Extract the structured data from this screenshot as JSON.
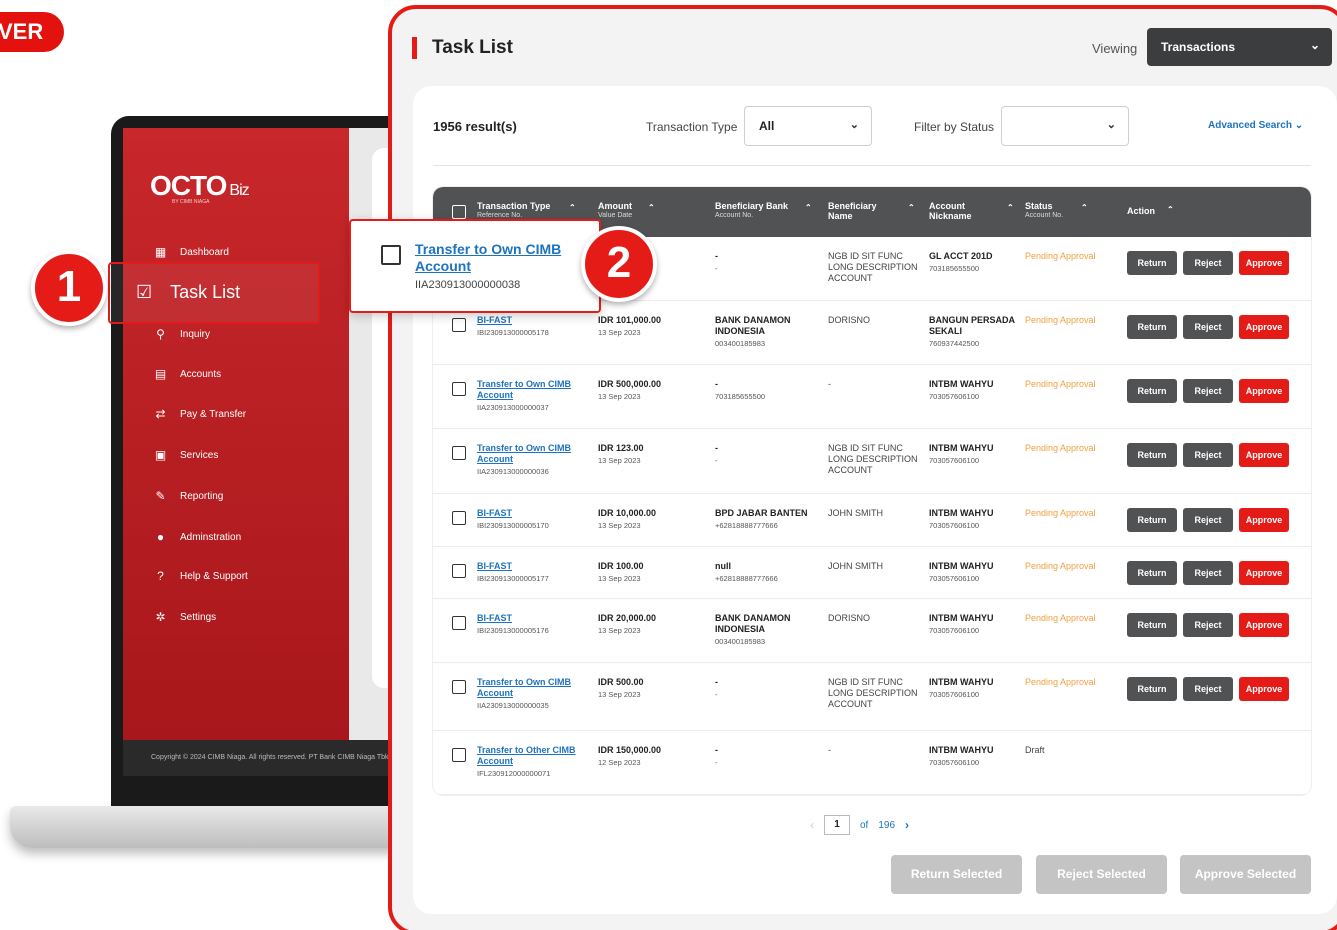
{
  "corner_pill": {
    "text": "VER"
  },
  "app": {
    "logo_text": "OCTO",
    "logo_suffix": "Biz",
    "logo_sub": "BY CIMB NIAGA",
    "footer": "Copyright © 2024 CIMB Niaga. All rights reserved. PT Bank CIMB Niaga Tbk",
    "nav": [
      {
        "label": "Dashboard",
        "icon": "dashboard-icon"
      },
      {
        "label": "Task List",
        "icon": "clipboard-check-icon"
      },
      {
        "label": "Inquiry",
        "icon": "search-icon"
      },
      {
        "label": "Accounts",
        "icon": "accounts-icon"
      },
      {
        "label": "Pay & Transfer",
        "icon": "transfer-icon"
      },
      {
        "label": "Services",
        "icon": "services-icon"
      },
      {
        "label": "Reporting",
        "icon": "wrench-icon"
      },
      {
        "label": "Adminstration",
        "icon": "user-icon"
      },
      {
        "label": "Help & Support",
        "icon": "help-icon"
      },
      {
        "label": "Settings",
        "icon": "gear-icon"
      }
    ]
  },
  "badges": {
    "one": "1",
    "two": "2"
  },
  "header": {
    "title": "Task List",
    "viewing_label": "Viewing",
    "viewing_value": "Transactions"
  },
  "filters": {
    "results": "1956 result(s)",
    "type_label": "Transaction Type",
    "type_value": "All",
    "status_label": "Filter by Status",
    "status_value": "",
    "advanced": "Advanced Search"
  },
  "table": {
    "columns": [
      {
        "label": "Transaction Type",
        "sub": "Reference No."
      },
      {
        "label": "Amount",
        "sub": "Value Date"
      },
      {
        "label": "Beneficiary Bank",
        "sub": "Account No."
      },
      {
        "label": "Beneficiary",
        "sub": "Name"
      },
      {
        "label": "Account",
        "sub": "Nickname"
      },
      {
        "label": "Status",
        "sub": "Account No."
      },
      {
        "label": "Action",
        "sub": ""
      }
    ],
    "buttons": {
      "return": "Return",
      "reject": "Reject",
      "approve": "Approve"
    },
    "rows": [
      {
        "type": "Transfer to Own CIMB Account",
        "ref": "IIA230913000000038",
        "amount": "",
        "date": "",
        "bank": "-",
        "bank_acc": "-",
        "beneficiary": "NGB ID SIT FUNC LONG DESCRIPTION ACCOUNT",
        "nickname": "GL ACCT 201D",
        "nick_acc": "703185655500",
        "status": "Pending Approval",
        "actions": true
      },
      {
        "type": "BI-FAST",
        "ref": "IBI230913000005178",
        "amount": "IDR 101,000.00",
        "date": "13 Sep 2023",
        "bank": "BANK DANAMON INDONESIA",
        "bank_acc": "003400185983",
        "beneficiary": "DORISNO",
        "nickname": "BANGUN PERSADA SEKALI",
        "nick_acc": "760937442500",
        "status": "Pending Approval",
        "actions": true
      },
      {
        "type": "Transfer to Own CIMB Account",
        "ref": "IIA230913000000037",
        "amount": "IDR 500,000.00",
        "date": "13 Sep 2023",
        "bank": "-",
        "bank_acc": "703185655500",
        "beneficiary": "-",
        "nickname": "INTBM WAHYU",
        "nick_acc": "703057606100",
        "status": "Pending Approval",
        "actions": true
      },
      {
        "type": "Transfer to Own CIMB Account",
        "ref": "IIA230913000000036",
        "amount": "IDR 123.00",
        "date": "13 Sep 2023",
        "bank": "-",
        "bank_acc": "-",
        "beneficiary": "NGB ID SIT FUNC LONG DESCRIPTION ACCOUNT",
        "nickname": "INTBM WAHYU",
        "nick_acc": "703057606100",
        "status": "Pending Approval",
        "actions": true
      },
      {
        "type": "BI-FAST",
        "ref": "IBI230913000005170",
        "amount": "IDR 10,000.00",
        "date": "13 Sep 2023",
        "bank": "BPD JABAR BANTEN",
        "bank_acc": "+62818888777666",
        "beneficiary": "JOHN SMITH",
        "nickname": "INTBM WAHYU",
        "nick_acc": "703057606100",
        "status": "Pending Approval",
        "actions": true
      },
      {
        "type": "BI-FAST",
        "ref": "IBI230913000005177",
        "amount": "IDR 100.00",
        "date": "13 Sep 2023",
        "bank": "null",
        "bank_acc": "+62818888777666",
        "beneficiary": "JOHN SMITH",
        "nickname": "INTBM WAHYU",
        "nick_acc": "703057606100",
        "status": "Pending Approval",
        "actions": true
      },
      {
        "type": "BI-FAST",
        "ref": "IBI230913000005176",
        "amount": "IDR 20,000.00",
        "date": "13 Sep 2023",
        "bank": "BANK DANAMON INDONESIA",
        "bank_acc": "003400185983",
        "beneficiary": "DORISNO",
        "nickname": "INTBM WAHYU",
        "nick_acc": "703057606100",
        "status": "Pending Approval",
        "actions": true
      },
      {
        "type": "Transfer to Own CIMB Account",
        "ref": "IIA230913000000035",
        "amount": "IDR 500.00",
        "date": "13 Sep 2023",
        "bank": "-",
        "bank_acc": "-",
        "beneficiary": "NGB ID SIT FUNC LONG DESCRIPTION ACCOUNT",
        "nickname": "INTBM WAHYU",
        "nick_acc": "703057606100",
        "status": "Pending Approval",
        "actions": true
      },
      {
        "type": "Transfer to Other CIMB Account",
        "ref": "IFL230912000000071",
        "amount": "IDR 150,000.00",
        "date": "12 Sep 2023",
        "bank": "-",
        "bank_acc": "-",
        "beneficiary": "-",
        "nickname": "INTBM WAHYU",
        "nick_acc": "703057606100",
        "status": "Draft",
        "actions": false
      }
    ]
  },
  "callout": {
    "link": "Transfer to Own CIMB Account",
    "ref": "IIA230913000000038"
  },
  "pager": {
    "current": "1",
    "of": "of",
    "total": "196"
  },
  "bulk": {
    "return": "Return Selected",
    "reject": "Reject Selected",
    "approve": "Approve Selected"
  },
  "colors": {
    "brand_red": "#e41b17",
    "dark": "#505254",
    "link": "#1e73be",
    "pending": "#f0a040",
    "disabled": "#c4c4c4"
  }
}
